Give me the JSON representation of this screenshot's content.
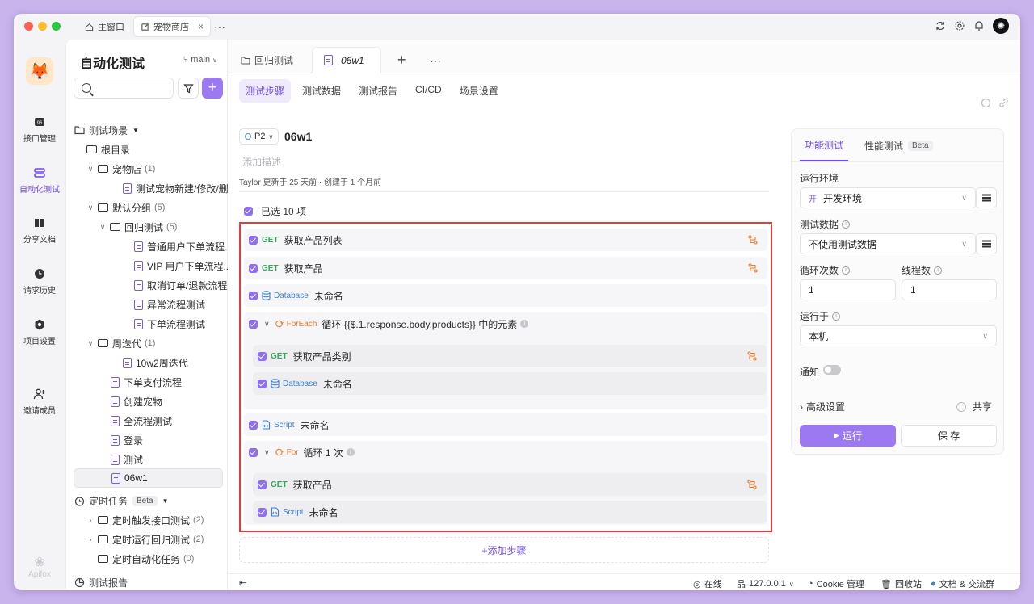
{
  "window_tabs": [
    {
      "label": "主窗口",
      "icon": "home-icon"
    },
    {
      "label": "宠物商店",
      "icon": "external-link-icon",
      "active": true
    }
  ],
  "rail": [
    {
      "label": "接口管理",
      "icon": "api-icon"
    },
    {
      "label": "自动化测试",
      "icon": "automation-icon",
      "active": true
    },
    {
      "label": "分享文档",
      "icon": "book-icon"
    },
    {
      "label": "请求历史",
      "icon": "history-icon"
    },
    {
      "label": "项目设置",
      "icon": "settings-icon"
    },
    {
      "label": "邀请成员",
      "icon": "add-user-icon"
    }
  ],
  "rail_footer": "Apifox",
  "tree": {
    "title": "自动化测试",
    "branch": "main",
    "section_scenes": "测试场景",
    "root": "根目录",
    "pet_store": {
      "label": "宠物店",
      "count": "(1)"
    },
    "pet_case": "测试宠物新建/修改/删...",
    "default_group": {
      "label": "默认分组",
      "count": "(5)"
    },
    "regression": {
      "label": "回归测试",
      "count": "(5)"
    },
    "regression_items": [
      "普通用户下单流程...",
      "VIP 用户下单流程...",
      "取消订单/退款流程...",
      "异常流程测试",
      "下单流程测试"
    ],
    "iteration": {
      "label": "周迭代",
      "count": "(1)"
    },
    "iteration_item": "10w2周迭代",
    "root_items": [
      "下单支付流程",
      "创建宠物",
      "全流程测试",
      "登录",
      "测试",
      "06w1"
    ],
    "section_schedule": "定时任务",
    "schedule_beta": "Beta",
    "schedule_items": [
      {
        "label": "定时触发接口测试",
        "count": "(2)"
      },
      {
        "label": "定时运行回归测试",
        "count": "(2)"
      },
      {
        "label": "定时自动化任务",
        "count": "(0)"
      }
    ],
    "section_reports": "测试报告"
  },
  "file_tabs": [
    {
      "label": "回归测试"
    },
    {
      "label": "06w1",
      "active": true
    }
  ],
  "subtabs": [
    "测试步骤",
    "测试数据",
    "测试报告",
    "CI/CD",
    "场景设置"
  ],
  "case": {
    "priority": "P2",
    "name": "06w1",
    "desc_placeholder": "添加描述",
    "meta": "Taylor 更新于 25 天前 · 创建于 1 个月前",
    "selected": "已选 10 项"
  },
  "steps": {
    "s1": {
      "method": "GET",
      "name": "获取产品列表"
    },
    "s2": {
      "method": "GET",
      "name": "获取产品"
    },
    "s3": {
      "method": "Database",
      "name": "未命名"
    },
    "s4": {
      "method": "ForEach",
      "name": "循环 {{$.1.response.body.products}} 中的元素"
    },
    "s4a": {
      "method": "GET",
      "name": "获取产品类别"
    },
    "s4b": {
      "method": "Database",
      "name": "未命名"
    },
    "s5": {
      "method": "Script",
      "name": "未命名"
    },
    "s6": {
      "method": "For",
      "name": "循环 1 次"
    },
    "s6a": {
      "method": "GET",
      "name": "获取产品"
    },
    "s6b": {
      "method": "Script",
      "name": "未命名"
    }
  },
  "add_step": "+添加步骤",
  "config": {
    "tab_func": "功能测试",
    "tab_perf": "性能测试",
    "tab_perf_badge": "Beta",
    "env_label": "运行环境",
    "env_tag": "开",
    "env_value": "开发环境",
    "data_label": "测试数据",
    "data_value": "不使用测试数据",
    "loop_label": "循环次数",
    "loop_value": "1",
    "thread_label": "线程数",
    "thread_value": "1",
    "run_on_label": "运行于",
    "run_on_value": "本机",
    "notify_label": "通知",
    "advanced": "高级设置",
    "share": "共享",
    "run": "运行",
    "save": "保 存"
  },
  "status": {
    "online": "在线",
    "host": "127.0.0.1",
    "cookie": "Cookie 管理",
    "trash": "回收站",
    "docs": "文档 & 交流群"
  }
}
